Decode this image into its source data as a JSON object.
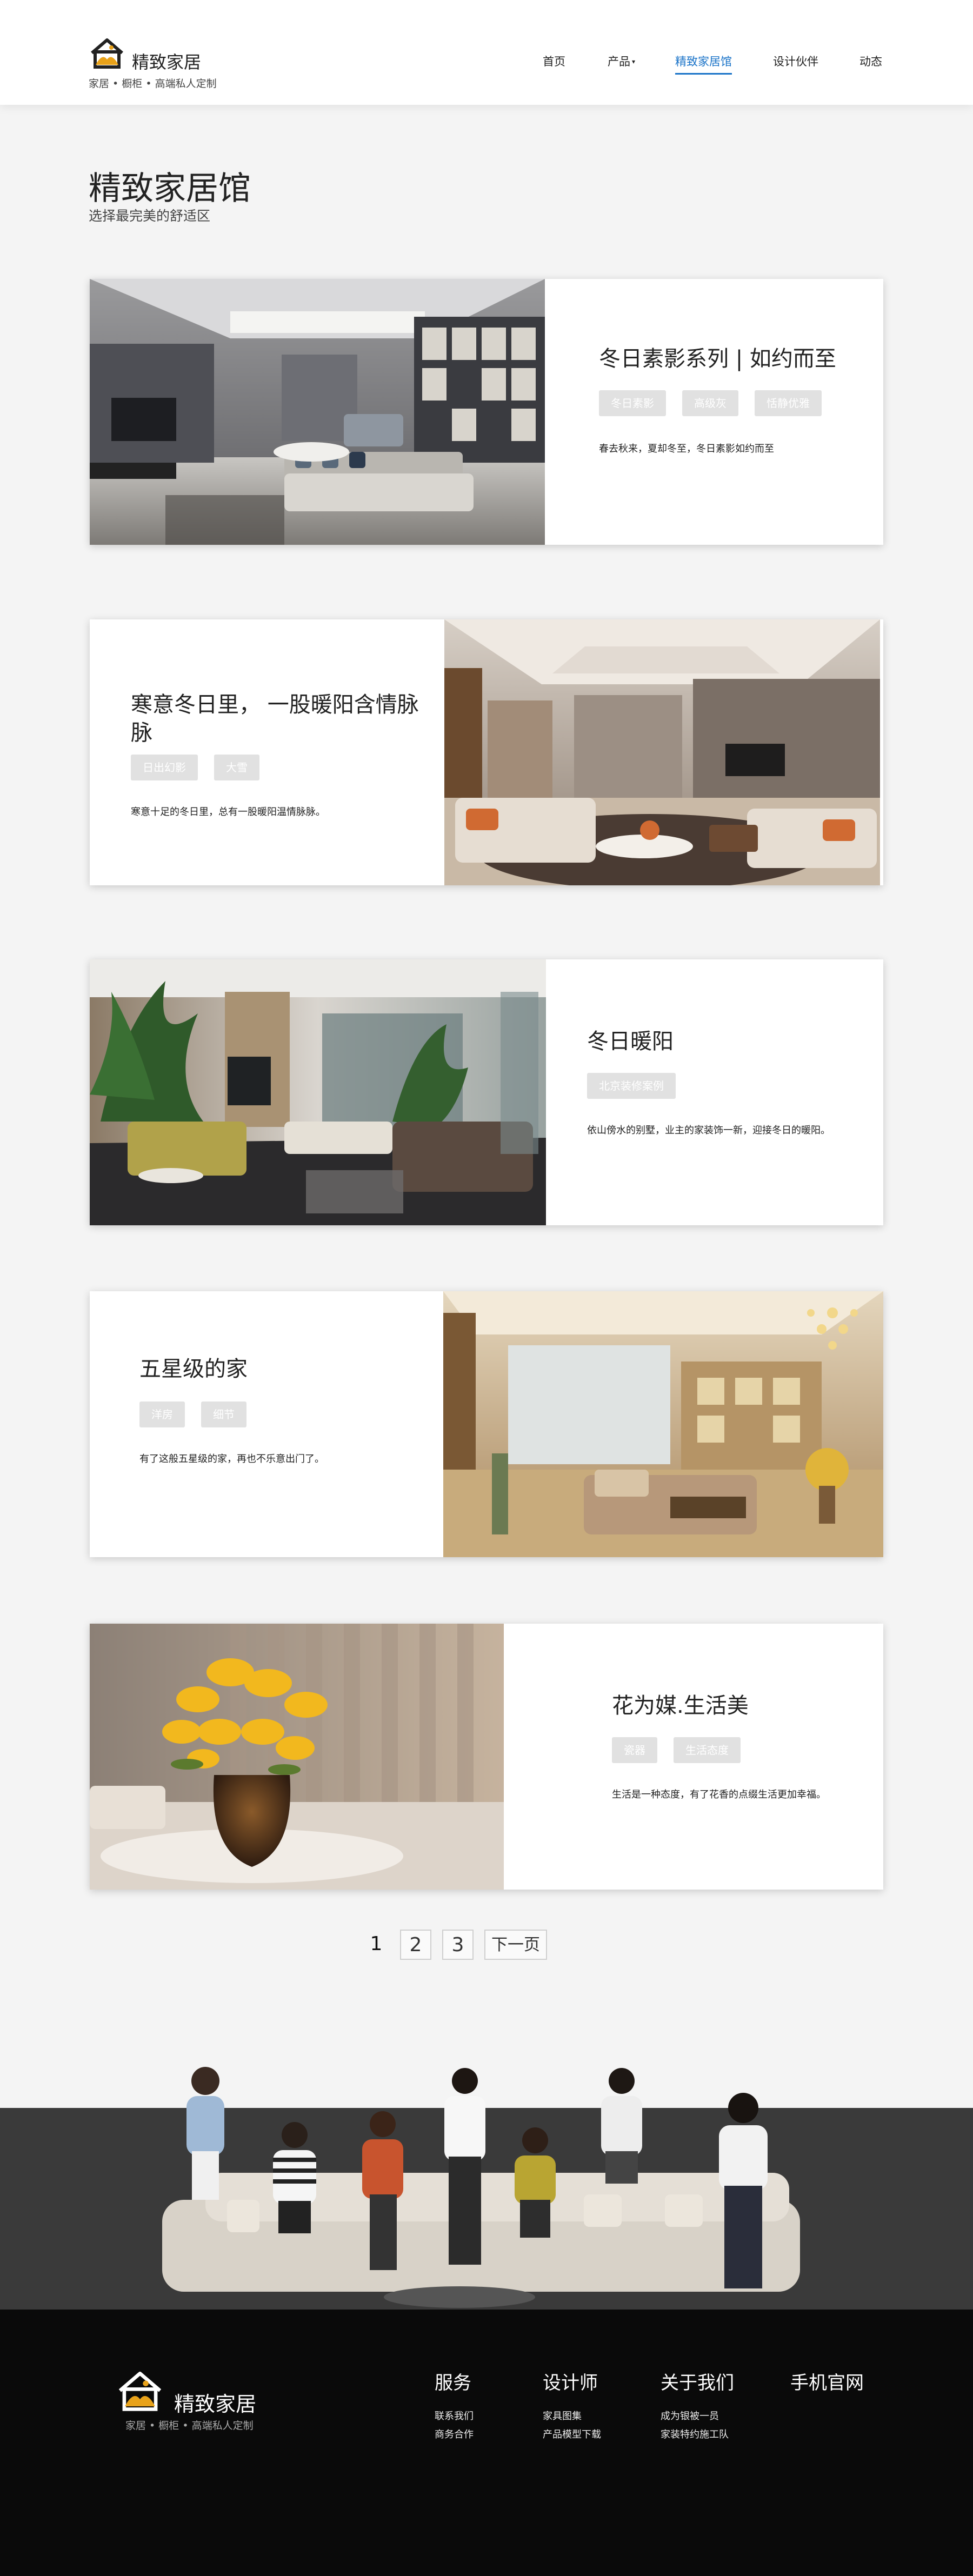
{
  "header": {
    "brand_name": "精致家居",
    "brand_slogan": "家居 • 橱柜 • 高端私人定制",
    "nav": [
      {
        "label": "首页"
      },
      {
        "label": "产品"
      },
      {
        "label": "精致家居馆"
      },
      {
        "label": "设计伙伴"
      },
      {
        "label": "动态"
      }
    ],
    "active_nav": "精致家居馆",
    "accent_color": "#1a73c8"
  },
  "page": {
    "title": "精致家居馆",
    "subtitle": "选择最完美的舒适区"
  },
  "cards": [
    {
      "title": "冬日素影系列 | 如约而至",
      "tags": [
        "冬日素影",
        "高级灰",
        "恬静优雅"
      ],
      "description": "春去秋来，夏却冬至，冬日素影如约而至"
    },
    {
      "title": "寒意冬日里， 一股暖阳含情脉脉",
      "tags": [
        "日出幻影",
        "大雪"
      ],
      "description": "寒意十足的冬日里，总有一股暖阳温情脉脉。"
    },
    {
      "title": "冬日暖阳",
      "tags": [
        "北京装修案例"
      ],
      "description": "依山傍水的别墅，业主的家装饰一新，迎接冬日的暖阳。"
    },
    {
      "title": "五星级的家",
      "tags": [
        "洋房",
        "细节"
      ],
      "description": "有了这般五星级的家，再也不乐意出门了。"
    },
    {
      "title": "花为媒.生活美",
      "tags": [
        "瓷器",
        "生活态度"
      ],
      "description": "生活是一种态度，有了花香的点缀生活更加幸福。"
    }
  ],
  "pagination": {
    "pages": [
      "1",
      "2",
      "3"
    ],
    "current": "1",
    "next_label": "下一页"
  },
  "footer": {
    "brand_name": "精致家居",
    "brand_slogan": "家居 • 橱柜 • 高端私人定制",
    "columns": [
      {
        "title": "服务",
        "links": [
          "联系我们",
          "商务合作"
        ]
      },
      {
        "title": "设计师",
        "links": [
          "家具图集",
          "产品模型下载"
        ]
      },
      {
        "title": "关于我们",
        "links": [
          "成为银被一员",
          "家装特约施工队"
        ]
      },
      {
        "title": "手机官网",
        "links": []
      }
    ]
  }
}
